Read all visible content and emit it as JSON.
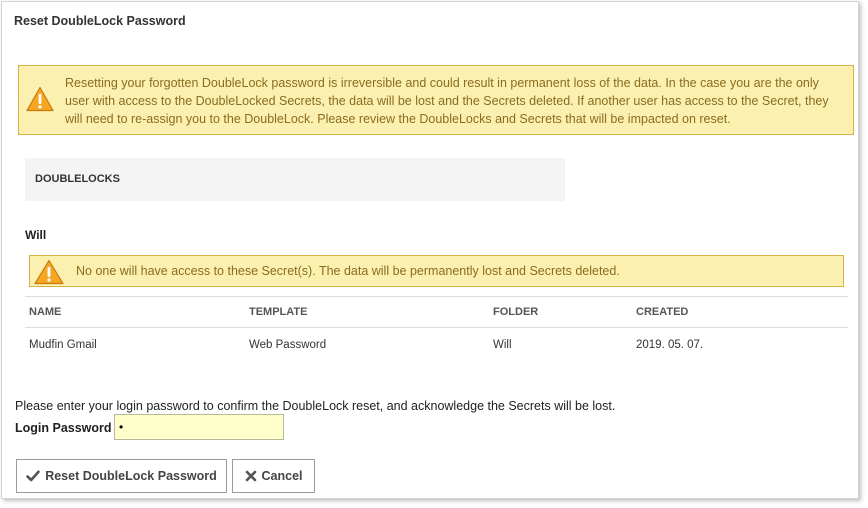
{
  "dialog": {
    "title": "Reset DoubleLock Password"
  },
  "warning": {
    "icon": "warning-triangle-icon",
    "text": "Resetting your forgotten DoubleLock password is irreversible and could result in permanent loss of the data. In the case you are the only user with access to the DoubleLocked Secrets, the data will be lost and the Secrets deleted. If another user has access to the Secret, they will need to re-assign you to the DoubleLock. Please review the DoubleLocks and Secrets that will be impacted on reset."
  },
  "doublelocks": {
    "heading": "DOUBLELOCKS",
    "groups": [
      {
        "name": "Will",
        "warning": "No one will have access to these Secret(s). The data will be permanently lost and Secrets deleted.",
        "columns": [
          "NAME",
          "TEMPLATE",
          "FOLDER",
          "CREATED"
        ],
        "rows": [
          [
            "Mudfin Gmail",
            "Web Password",
            "Will",
            "2019. 05. 07."
          ]
        ]
      }
    ]
  },
  "confirm": {
    "text": "Please enter your login password to confirm the DoubleLock reset, and acknowledge the Secrets will be lost.",
    "password_label": "Login Password",
    "password_value": "•"
  },
  "buttons": {
    "reset_label": "Reset DoubleLock Password",
    "reset_icon": "check-icon",
    "cancel_label": "Cancel",
    "cancel_icon": "close-icon"
  },
  "colors": {
    "warning_bg": "#fcf0b0",
    "warning_border": "#d6b24a",
    "warning_text": "#8a6d1f",
    "input_bg": "#ffffcc"
  }
}
